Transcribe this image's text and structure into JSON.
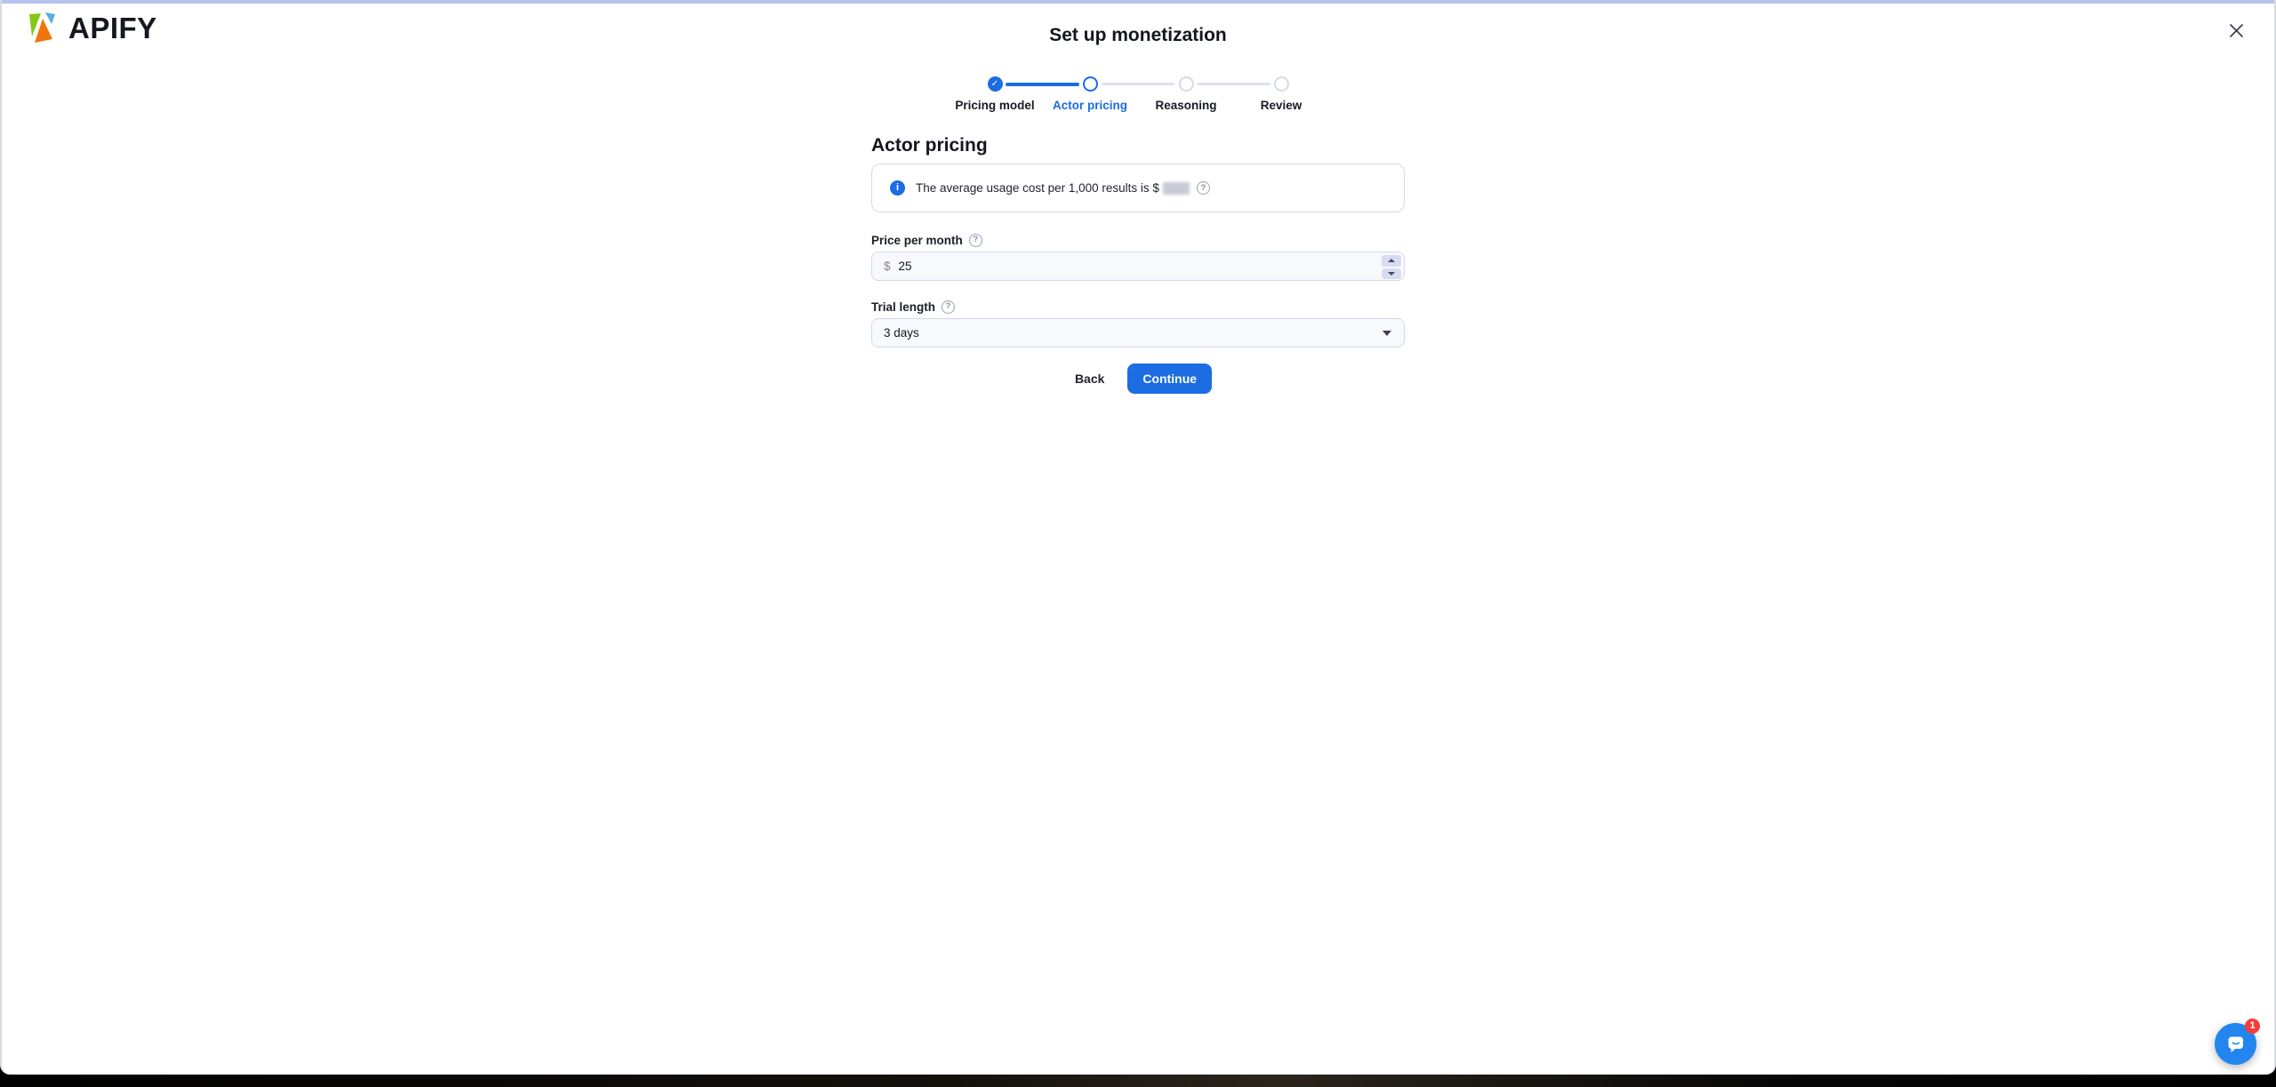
{
  "theme": {
    "accent_blue": "#1c6ce2",
    "chat_launcher_blue": "#2286ee",
    "badge_red": "#fb3a3a",
    "logo_green": "#86c716",
    "logo_orange": "#f2740d",
    "logo_blue": "#56aee3"
  },
  "header": {
    "brand": "APIFY",
    "title": "Set up monetization"
  },
  "icons": {
    "close": "✕",
    "info": "i",
    "help": "?",
    "step_check": "✓"
  },
  "stepper": {
    "steps": [
      {
        "label": "Pricing model",
        "state": "completed"
      },
      {
        "label": "Actor pricing",
        "state": "active"
      },
      {
        "label": "Reasoning",
        "state": "upcoming"
      },
      {
        "label": "Review",
        "state": "upcoming"
      }
    ]
  },
  "main": {
    "heading": "Actor pricing",
    "info_banner": {
      "text": "The average usage cost per 1,000 results is $",
      "value_redacted": true
    },
    "price_field": {
      "label": "Price per month",
      "currency_prefix": "$",
      "value": "25"
    },
    "trial_field": {
      "label": "Trial length",
      "selected_option": "3 days"
    }
  },
  "footer": {
    "back_label": "Back",
    "continue_label": "Continue"
  },
  "chat": {
    "badge_count": "1"
  }
}
